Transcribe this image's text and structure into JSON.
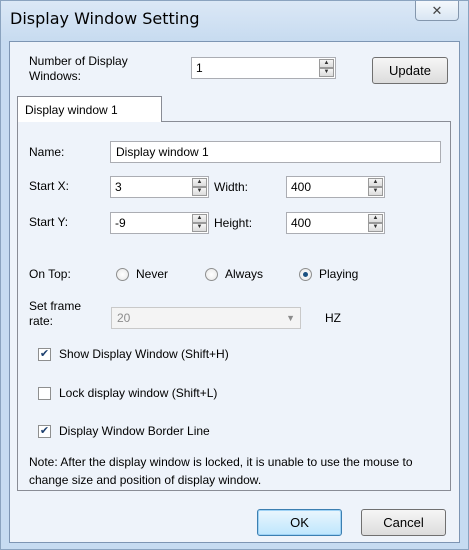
{
  "window": {
    "title": "Display Window Setting",
    "close_glyph": "✕"
  },
  "top": {
    "num_windows_label": "Number of Display Windows:",
    "num_windows_value": "1",
    "update_label": "Update"
  },
  "tab": {
    "label": "Display window 1"
  },
  "form": {
    "name_label": "Name:",
    "name_value": "Display window 1",
    "start_x_label": "Start X:",
    "start_x_value": "3",
    "width_label": "Width:",
    "width_value": "400",
    "start_y_label": "Start Y:",
    "start_y_value": "-9",
    "height_label": "Height:",
    "height_value": "400",
    "on_top_label": "On Top:",
    "on_top_options": [
      "Never",
      "Always",
      "Playing"
    ],
    "on_top_selected": "Playing",
    "frame_rate_label": "Set frame rate:",
    "frame_rate_value": "20",
    "frame_rate_unit": "HZ",
    "checkboxes": [
      {
        "label": "Show Display Window (Shift+H)",
        "checked": true
      },
      {
        "label": "Lock display window (Shift+L)",
        "checked": false
      },
      {
        "label": "Display Window Border Line",
        "checked": true
      }
    ],
    "note": "Note: After the display window is locked, it is unable to use the mouse to change size and position of display window."
  },
  "buttons": {
    "ok_label": "OK",
    "cancel_label": "Cancel"
  },
  "icons": {
    "spin_up": "▲",
    "spin_down": "▼",
    "dropdown": "▼",
    "check": "✔"
  }
}
